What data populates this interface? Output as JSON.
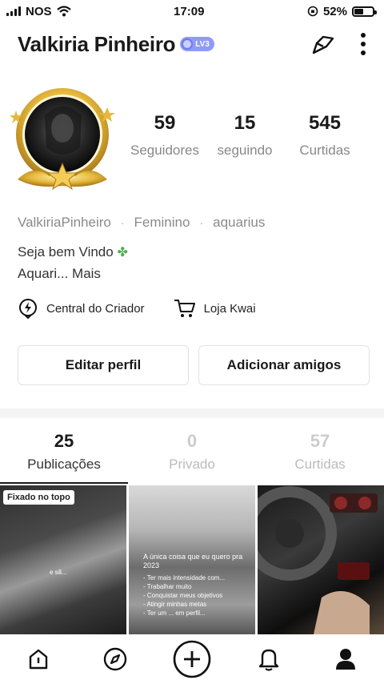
{
  "status_bar": {
    "carrier": "NOS",
    "time": "17:09",
    "battery": "52%",
    "battery_level": 0.52
  },
  "header": {
    "title": "Valkiria Pinheiro",
    "level": "LV3"
  },
  "stats": [
    {
      "value": "59",
      "label": "Seguidores"
    },
    {
      "value": "15",
      "label": "seguindo"
    },
    {
      "value": "545",
      "label": "Curtidas"
    }
  ],
  "meta": {
    "handle": "ValkiriaPinheiro",
    "gender": "Feminino",
    "sign": "aquarius"
  },
  "bio": {
    "line1": "Seja bem Vindo",
    "line2": "Aquari... Mais"
  },
  "shortcuts": {
    "creator": "Central do Criador",
    "shop": "Loja Kwai"
  },
  "buttons": {
    "edit": "Editar perfil",
    "add_friends": "Adicionar amigos"
  },
  "tabs": [
    {
      "count": "25",
      "label": "Publicações"
    },
    {
      "count": "0",
      "label": "Privado"
    },
    {
      "count": "57",
      "label": "Curtidas"
    }
  ],
  "grid": {
    "pinned_label": "Fixado no topo",
    "cell1_caption": "e sã...",
    "cell2_heading": "A única coisa que eu quero pra 2023",
    "cell2_lines": [
      "- Ter mais intensidade com...",
      "- Trabalhar muito",
      "- Conquistar meus objetivos",
      "- Atingir minhas metas",
      "- Ter um ... em perfil..."
    ]
  },
  "icons": {
    "share": "share-icon",
    "more": "more-icon",
    "creator": "lightning-icon",
    "shop": "cart-icon",
    "home": "home-icon",
    "discover": "compass-icon",
    "create": "plus-icon",
    "notifications": "bell-icon",
    "profile": "profile-icon"
  }
}
